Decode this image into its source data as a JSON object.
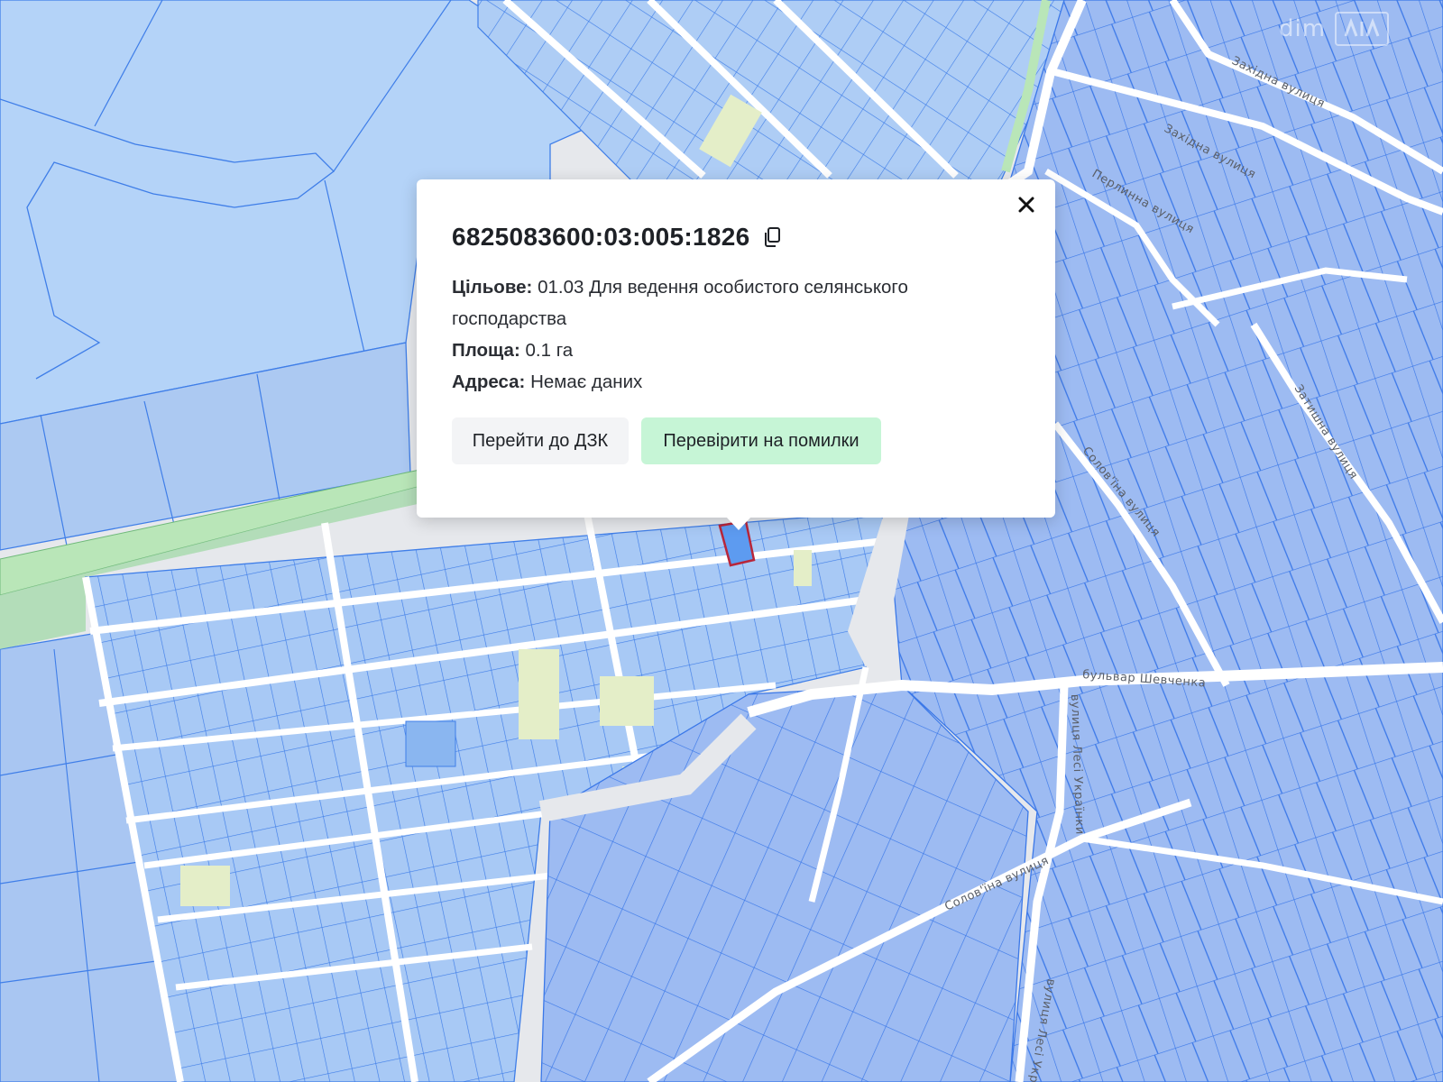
{
  "watermark": {
    "brand_text": "dim",
    "logo_text": "RIA"
  },
  "popup": {
    "cadastral_number": "6825083600:03:005:1826",
    "purpose_label": "Цільове:",
    "purpose_value": "01.03 Для ведення особистого селянського господарства",
    "area_label": "Площа:",
    "area_value": "0.1 га",
    "address_label": "Адреса:",
    "address_value": "Немає даних",
    "buttons": {
      "go_to_dzk": "Перейти до ДЗК",
      "check_errors": "Перевірити на помилки"
    },
    "icons": {
      "copy": "copy-icon",
      "close": "close-icon"
    }
  },
  "map": {
    "street_labels": [
      "Західна вулиця",
      "Західна вулиця",
      "Перлинна вулиця",
      "Затишна вулиця",
      "Солов'їна вулиця",
      "бульвар Шевченка",
      "вулиця Лесі Українки",
      "Солов'їна вулиця",
      "вулиця Лесі Українки"
    ],
    "colors": {
      "parcel_fill": "#a8c9f5",
      "parcel_border": "#3f7ee8",
      "urban_parcel_fill": "#9dbbf2",
      "field_fill": "#b6d4f8",
      "selected_parcel_fill": "#5d9bf0",
      "selected_parcel_border": "#b8263a",
      "green_strip": "#b9e6b8",
      "vacant_lot": "#e4eec8",
      "road": "#ffffff",
      "background": "#e6e8ec",
      "accent_green": "#c6f5d6"
    }
  }
}
